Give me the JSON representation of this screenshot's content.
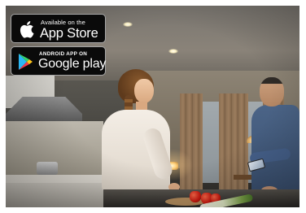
{
  "badges": {
    "app_store": {
      "line1": "Available on the",
      "line2": "App Store",
      "icon": "apple-icon"
    },
    "google_play": {
      "line1": "ANDROID APP ON",
      "line2": "Google play",
      "icon": "google-play-icon"
    }
  },
  "colors": {
    "badge_background": "#0a0a0a",
    "badge_border": "#a6a6a6",
    "badge_text": "#ffffff"
  },
  "photo": {
    "subject": "kitchen-scene-photo"
  }
}
